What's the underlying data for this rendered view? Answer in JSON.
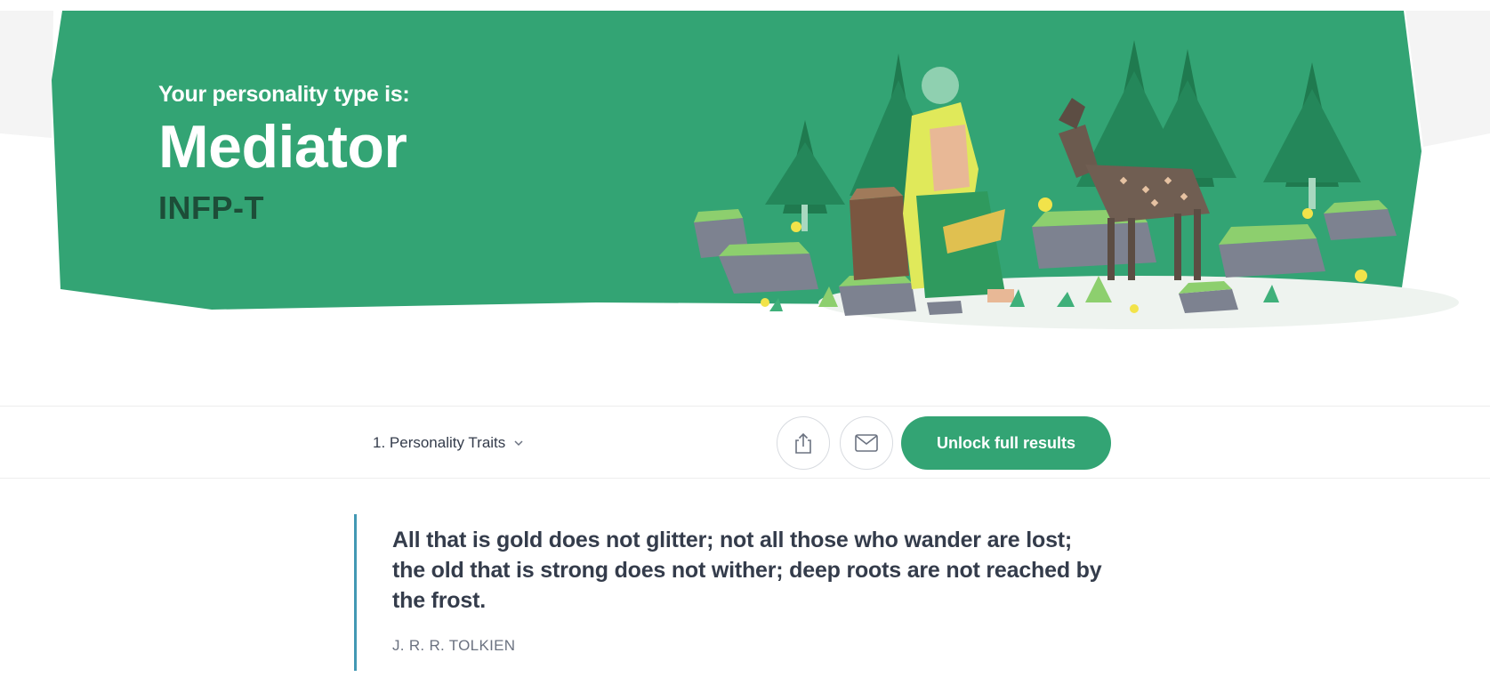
{
  "hero": {
    "pre_title": "Your personality type is:",
    "type_name": "Mediator",
    "type_code": "INFP-T",
    "colors": {
      "banner": "#33a474",
      "code": "#1d4d38"
    }
  },
  "toolbar": {
    "section_label": "1. Personality Traits",
    "share_icon": "share-icon",
    "email_icon": "email-icon",
    "unlock_label": "Unlock full results",
    "accent": "#33a474"
  },
  "quote": {
    "line1": "All that is gold does not glitter; not all those who wander are lost;",
    "line2": "the old that is strong does not wither; deep roots are not reached by the frost.",
    "author": "J. R. R. TOLKIEN",
    "border_color": "#4298b4"
  }
}
